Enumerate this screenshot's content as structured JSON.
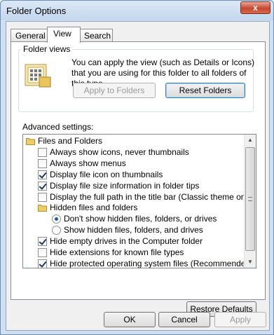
{
  "window": {
    "title": "Folder Options",
    "close_glyph": "x"
  },
  "tabs": [
    {
      "label": "General",
      "active": false
    },
    {
      "label": "View",
      "active": true
    },
    {
      "label": "Search",
      "active": false
    }
  ],
  "folder_views": {
    "group_label": "Folder views",
    "description": "You can apply the view (such as Details or Icons) that you are using for this folder to all folders of this type.",
    "apply_button": "Apply to Folders",
    "reset_button": "Reset Folders"
  },
  "advanced": {
    "label": "Advanced settings:",
    "items": [
      {
        "type": "folder",
        "label": "Files and Folders",
        "level": 0
      },
      {
        "type": "checkbox",
        "label": "Always show icons, never thumbnails",
        "checked": false,
        "level": 1
      },
      {
        "type": "checkbox",
        "label": "Always show menus",
        "checked": false,
        "level": 1
      },
      {
        "type": "checkbox",
        "label": "Display file icon on thumbnails",
        "checked": true,
        "level": 1
      },
      {
        "type": "checkbox",
        "label": "Display file size information in folder tips",
        "checked": true,
        "level": 1
      },
      {
        "type": "checkbox",
        "label": "Display the full path in the title bar (Classic theme only)",
        "checked": false,
        "level": 1
      },
      {
        "type": "folder",
        "label": "Hidden files and folders",
        "level": 1
      },
      {
        "type": "radio",
        "label": "Don't show hidden files, folders, or drives",
        "checked": true,
        "level": 2
      },
      {
        "type": "radio",
        "label": "Show hidden files, folders, and drives",
        "checked": false,
        "level": 2
      },
      {
        "type": "checkbox",
        "label": "Hide empty drives in the Computer folder",
        "checked": true,
        "level": 1
      },
      {
        "type": "checkbox",
        "label": "Hide extensions for known file types",
        "checked": false,
        "level": 1
      },
      {
        "type": "checkbox",
        "label": "Hide protected operating system files (Recommended)",
        "checked": true,
        "level": 1
      }
    ]
  },
  "buttons": {
    "restore_defaults": "Restore Defaults",
    "ok": "OK",
    "cancel": "Cancel",
    "apply": "Apply"
  },
  "colors": {
    "title_bar": "#c4d7ee",
    "close_button": "#c8482f",
    "focus_border": "#3c7fb1"
  }
}
